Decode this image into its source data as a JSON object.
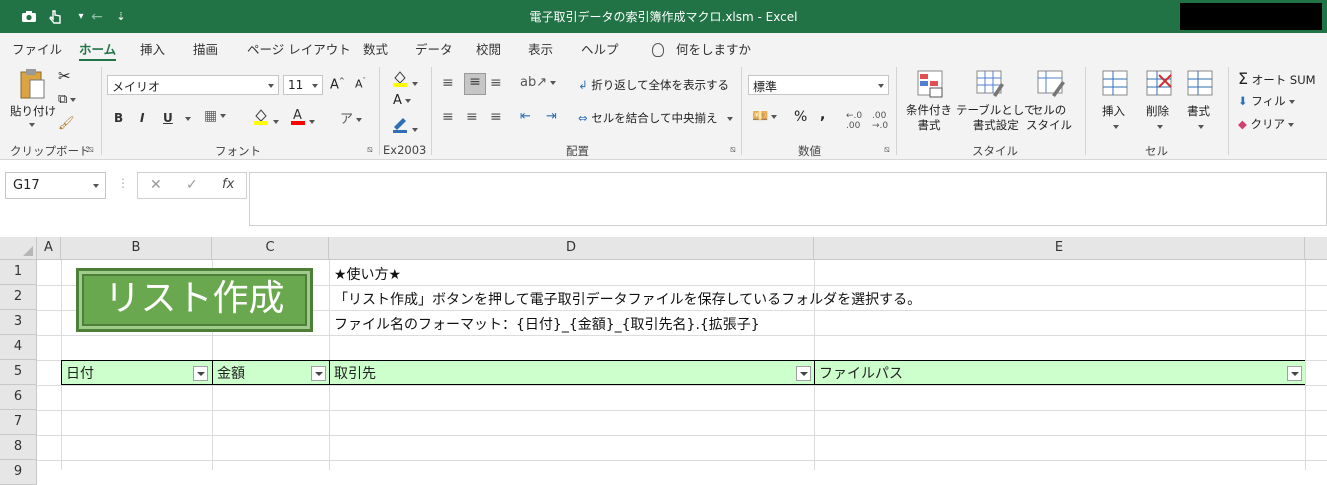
{
  "window": {
    "title": "電子取引データの索引簿作成マクロ.xlsm  -  Excel"
  },
  "ribbon_tabs": [
    "ファイル",
    "ホーム",
    "挿入",
    "描画",
    "ページ レイアウト",
    "数式",
    "データ",
    "校閲",
    "表示",
    "ヘルプ"
  ],
  "tell_me": "何をしますか",
  "clipboard": {
    "paste": "貼り付け",
    "group": "クリップボード"
  },
  "font": {
    "name": "メイリオ",
    "size": "11",
    "group": "フォント",
    "bold": "B",
    "italic": "I",
    "underline": "U"
  },
  "ex2003": {
    "group": "Ex2003"
  },
  "alignment": {
    "wrap": "折り返して全体を表示する",
    "merge": "セルを結合して中央揃え",
    "group": "配置"
  },
  "number": {
    "format": "標準",
    "group": "数値",
    "percent": "%",
    "comma": ","
  },
  "styles": {
    "conditional": "条件付き\n書式",
    "table": "テーブルとして\n書式設定",
    "cell": "セルの\nスタイル",
    "group": "スタイル"
  },
  "cells": {
    "insert": "挿入",
    "delete": "削除",
    "format": "書式",
    "group": "セル"
  },
  "editing": {
    "autosum": "オート SUM",
    "fill": "フィル",
    "clear": "クリア"
  },
  "formula_bar": {
    "name_box": "G17",
    "cancel": "✕",
    "enter": "✓",
    "fx": "fx",
    "content": ""
  },
  "columns": [
    "A",
    "B",
    "C",
    "D",
    "E"
  ],
  "rows": [
    "1",
    "2",
    "3",
    "4",
    "5",
    "6",
    "7",
    "8",
    "9"
  ],
  "sheet": {
    "button_label": "リスト作成",
    "d1": "★使い方★",
    "d2": "「リスト作成」ボタンを押して電子取引データファイルを保存しているフォルダを選択する。",
    "d3": "ファイル名のフォーマット：{日付}_{金額}_{取引先名}.{拡張子}",
    "headers": [
      "日付",
      "金額",
      "取引先",
      "ファイルパス"
    ]
  },
  "colors": {
    "excel_green": "#217346",
    "header_fill": "#ccffcc",
    "button_fill": "#6aa84f"
  }
}
